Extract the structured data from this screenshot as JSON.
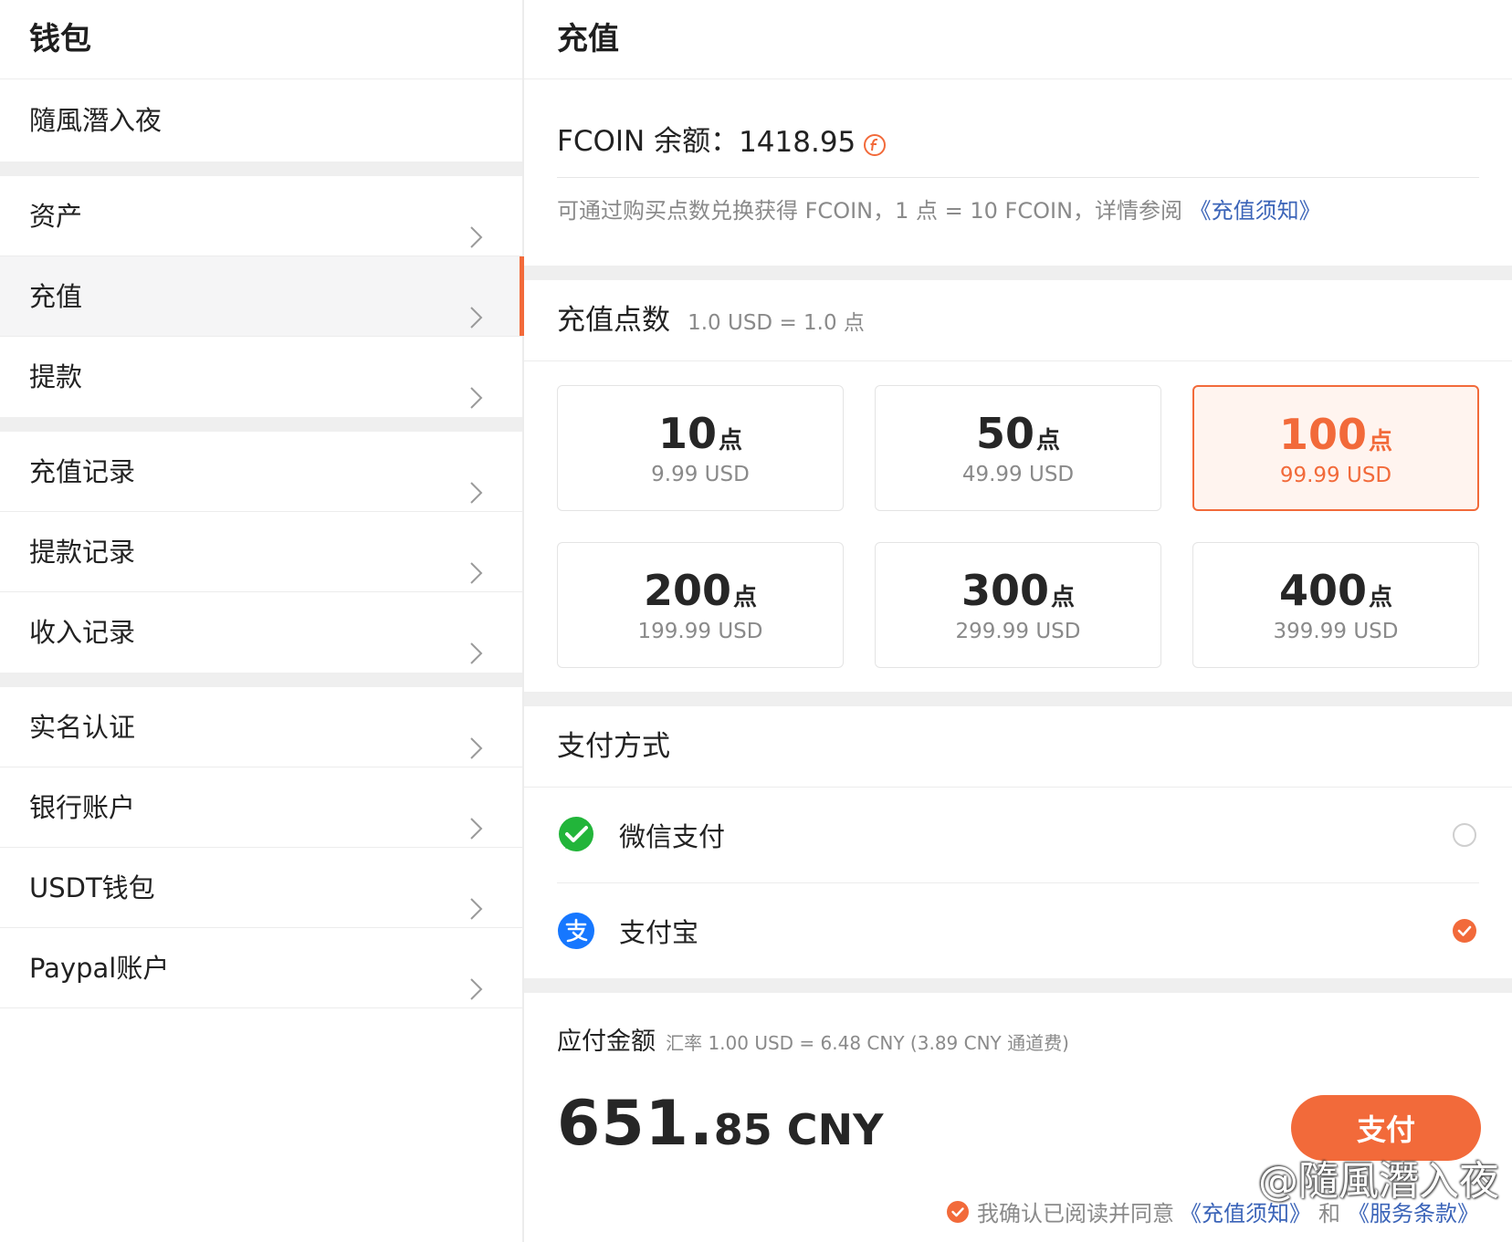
{
  "sidebar": {
    "title": "钱包",
    "user": "隨風潛入夜",
    "groups": [
      [
        {
          "label": "资产"
        },
        {
          "label": "充值"
        },
        {
          "label": "提款"
        }
      ],
      [
        {
          "label": "充值记录"
        },
        {
          "label": "提款记录"
        },
        {
          "label": "收入记录"
        }
      ],
      [
        {
          "label": "实名认证"
        },
        {
          "label": "银行账户"
        },
        {
          "label": "USDT钱包"
        },
        {
          "label": "Paypal账户"
        }
      ]
    ],
    "active": "充值"
  },
  "main": {
    "title": "充值",
    "balance_label": "FCOIN 余额：",
    "balance_value": "1418.95",
    "note_text": "可通过购买点数兑换获得 FCOIN，1 点 = 10 FCOIN，详情参阅",
    "note_link": "《充值须知》",
    "points_heading": "充值点数",
    "points_rate": "1.0 USD = 1.0 点",
    "packages": [
      {
        "points": "10",
        "unit": "点",
        "price": "9.99  USD"
      },
      {
        "points": "50",
        "unit": "点",
        "price": "49.99  USD"
      },
      {
        "points": "100",
        "unit": "点",
        "price": "99.99  USD"
      },
      {
        "points": "200",
        "unit": "点",
        "price": "199.99  USD"
      },
      {
        "points": "300",
        "unit": "点",
        "price": "299.99  USD"
      },
      {
        "points": "400",
        "unit": "点",
        "price": "399.99  USD"
      }
    ],
    "selected_package": "100",
    "payment_heading": "支付方式",
    "payment_methods": [
      {
        "label": "微信支付",
        "icon": "wechat-pay-icon",
        "selected": false
      },
      {
        "label": "支付宝",
        "icon": "alipay-icon",
        "selected": true
      }
    ],
    "due_heading": "应付金额",
    "due_rate": "汇率 1.00 USD = 6.48 CNY (3.89 CNY 通道费)",
    "amount_int": "651.",
    "amount_dec": "85 CNY",
    "pay_button": "支付",
    "agree_text": "我确认已阅读并同意",
    "agree_link1": "《充值须知》",
    "agree_and": "和",
    "agree_link2": "《服务条款》"
  },
  "watermark": "@隨風潛入夜",
  "colors": {
    "accent": "#f26a3a",
    "link": "#3b64b8",
    "wechat": "#22b53a",
    "alipay": "#1677ff"
  }
}
